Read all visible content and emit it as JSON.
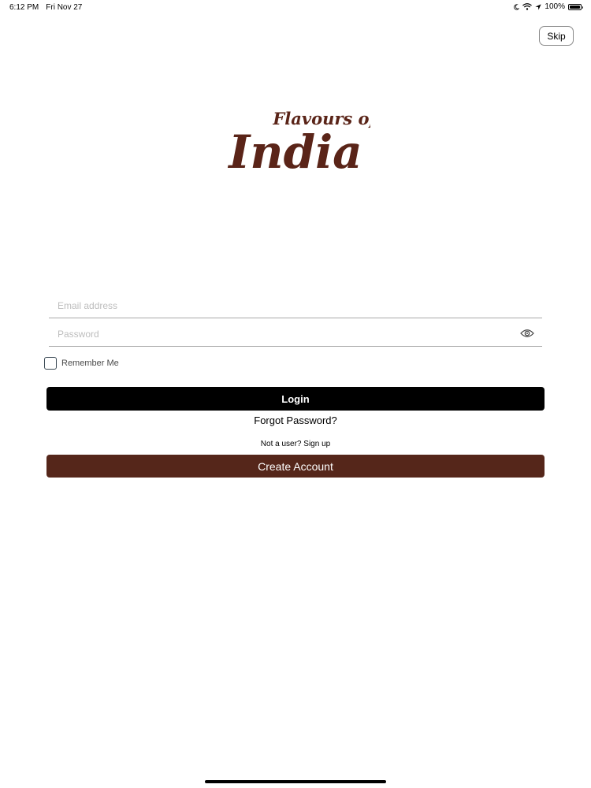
{
  "status_bar": {
    "time": "6:12 PM",
    "date": "Fri Nov 27",
    "battery": "100%",
    "battery_level": 1.0
  },
  "header": {
    "skip_label": "Skip"
  },
  "logo": {
    "line1": "Flavours of",
    "line2": "India",
    "color": "#5a2418"
  },
  "form": {
    "email_placeholder": "Email address",
    "email_value": "",
    "password_placeholder": "Password",
    "password_value": "",
    "remember_label": "Remember Me",
    "remember_checked": false
  },
  "actions": {
    "login_label": "Login",
    "forgot_label": "Forgot Password?",
    "signup_prompt": "Not a user? Sign up",
    "create_label": "Create Account"
  },
  "colors": {
    "login_button": "#000000",
    "create_button": "#55261a"
  }
}
